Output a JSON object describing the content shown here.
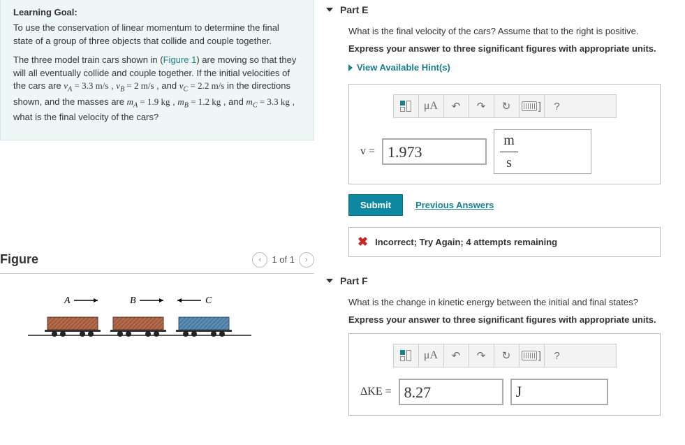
{
  "learning_goal": {
    "title": "Learning Goal:",
    "para1": "To use the conservation of linear momentum to determine the final state of a group of three objects that collide and couple together.",
    "para2_pre": "The three model train cars shown in (",
    "figure_link": "Figure 1",
    "para2_mid1": ") are moving so that they will all eventually collide and couple together. If the initial velocities of the cars are ",
    "vA": "v",
    "vA_sub": "A",
    "vA_eq": " = 3.3 m/s",
    "sep1": " , ",
    "vB": "v",
    "vB_sub": "B",
    "vB_eq": " = 2 m/s",
    "sep2": " , and ",
    "vC": "v",
    "vC_sub": "C",
    "vC_eq": " = 2.2 m/s",
    "para2_mid2": " in the directions shown, and the masses are ",
    "mA": "m",
    "mA_sub": "A",
    "mA_eq": " = 1.9 kg",
    "sep3": " , ",
    "mB": "m",
    "mB_sub": "B",
    "mB_eq": " = 1.2 kg",
    "sep4": " , and ",
    "mC": "m",
    "mC_sub": "C",
    "mC_eq": " = 3.3 kg",
    "para2_end": " , what is the final velocity of the cars?"
  },
  "figure": {
    "title": "Figure",
    "pager": "1 of 1",
    "labels": {
      "A": "A",
      "B": "B",
      "C": "C"
    }
  },
  "partE": {
    "heading": "Part E",
    "prompt": "What is the final velocity of the cars? Assume that to the right is positive.",
    "instruct": "Express your answer to three significant figures with appropriate units.",
    "hints": "View Available Hint(s)",
    "var": "v = ",
    "value": "1.973",
    "unit_num": "m",
    "unit_den": "s",
    "submit": "Submit",
    "prev": "Previous Answers",
    "feedback": "Incorrect; Try Again; 4 attempts remaining",
    "tb_mu": "μA",
    "tb_q": "?",
    "tb_ket": "]"
  },
  "partF": {
    "heading": "Part F",
    "prompt": "What is the change in kinetic energy between the initial and final states?",
    "instruct": "Express your answer to three significant figures with appropriate units.",
    "var": "ΔKE = ",
    "value": "8.27",
    "unit": "J",
    "tb_mu": "μA",
    "tb_q": "?",
    "tb_ket": "]"
  }
}
